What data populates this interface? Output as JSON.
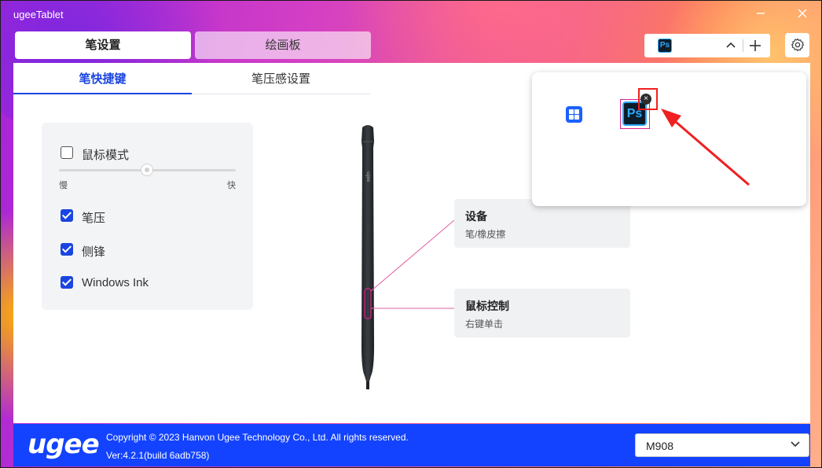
{
  "window": {
    "title": "ugeeTablet",
    "minimize_icon": "minimize-icon",
    "close_icon": "close-icon"
  },
  "main_tabs": [
    {
      "label": "笔设置",
      "active": true
    },
    {
      "label": "绘画板",
      "active": false
    }
  ],
  "app_selector": {
    "current_app_icon": "photoshop-icon",
    "current_app_label": "Ps",
    "arrow_icon": "chevron-up-icon",
    "add_icon": "plus-icon"
  },
  "settings_icon": "gear-icon",
  "sub_tabs": [
    {
      "label": "笔快捷键",
      "active": true
    },
    {
      "label": "笔压感设置",
      "active": false
    }
  ],
  "settings_card": {
    "mouse_mode": {
      "label": "鼠标模式",
      "checked": false
    },
    "speed_slider": {
      "min_label": "慢",
      "max_label": "快",
      "value": 0.5
    },
    "pressure": {
      "label": "笔压",
      "checked": true
    },
    "tilt": {
      "label": "侧锋",
      "checked": true
    },
    "windows_ink": {
      "label": "Windows Ink",
      "checked": true
    }
  },
  "pen_buttons": [
    {
      "title": "设备",
      "subtitle": "笔/橡皮擦"
    },
    {
      "title": "鼠标控制",
      "subtitle": "右键单击"
    }
  ],
  "pen_brand": "ugee",
  "app_popup": {
    "apps": [
      {
        "icon": "all-apps-grid-icon"
      },
      {
        "icon": "photoshop-icon",
        "label": "Ps",
        "selected": true
      }
    ],
    "remove_icon": "remove-badge-icon"
  },
  "annotation": {
    "color": "#f02020"
  },
  "footer": {
    "logo": "ugee",
    "copyright": "Copyright © 2023 Hanvon Ugee Technology Co., Ltd. All rights reserved.",
    "version": "Ver:4.2.1(build 6adb758)",
    "device": "M908",
    "device_chevron": "chevron-down-icon"
  },
  "colors": {
    "accent": "#1a45e0",
    "footer_bg": "#1343ff",
    "highlight_pink": "#e0208c"
  }
}
